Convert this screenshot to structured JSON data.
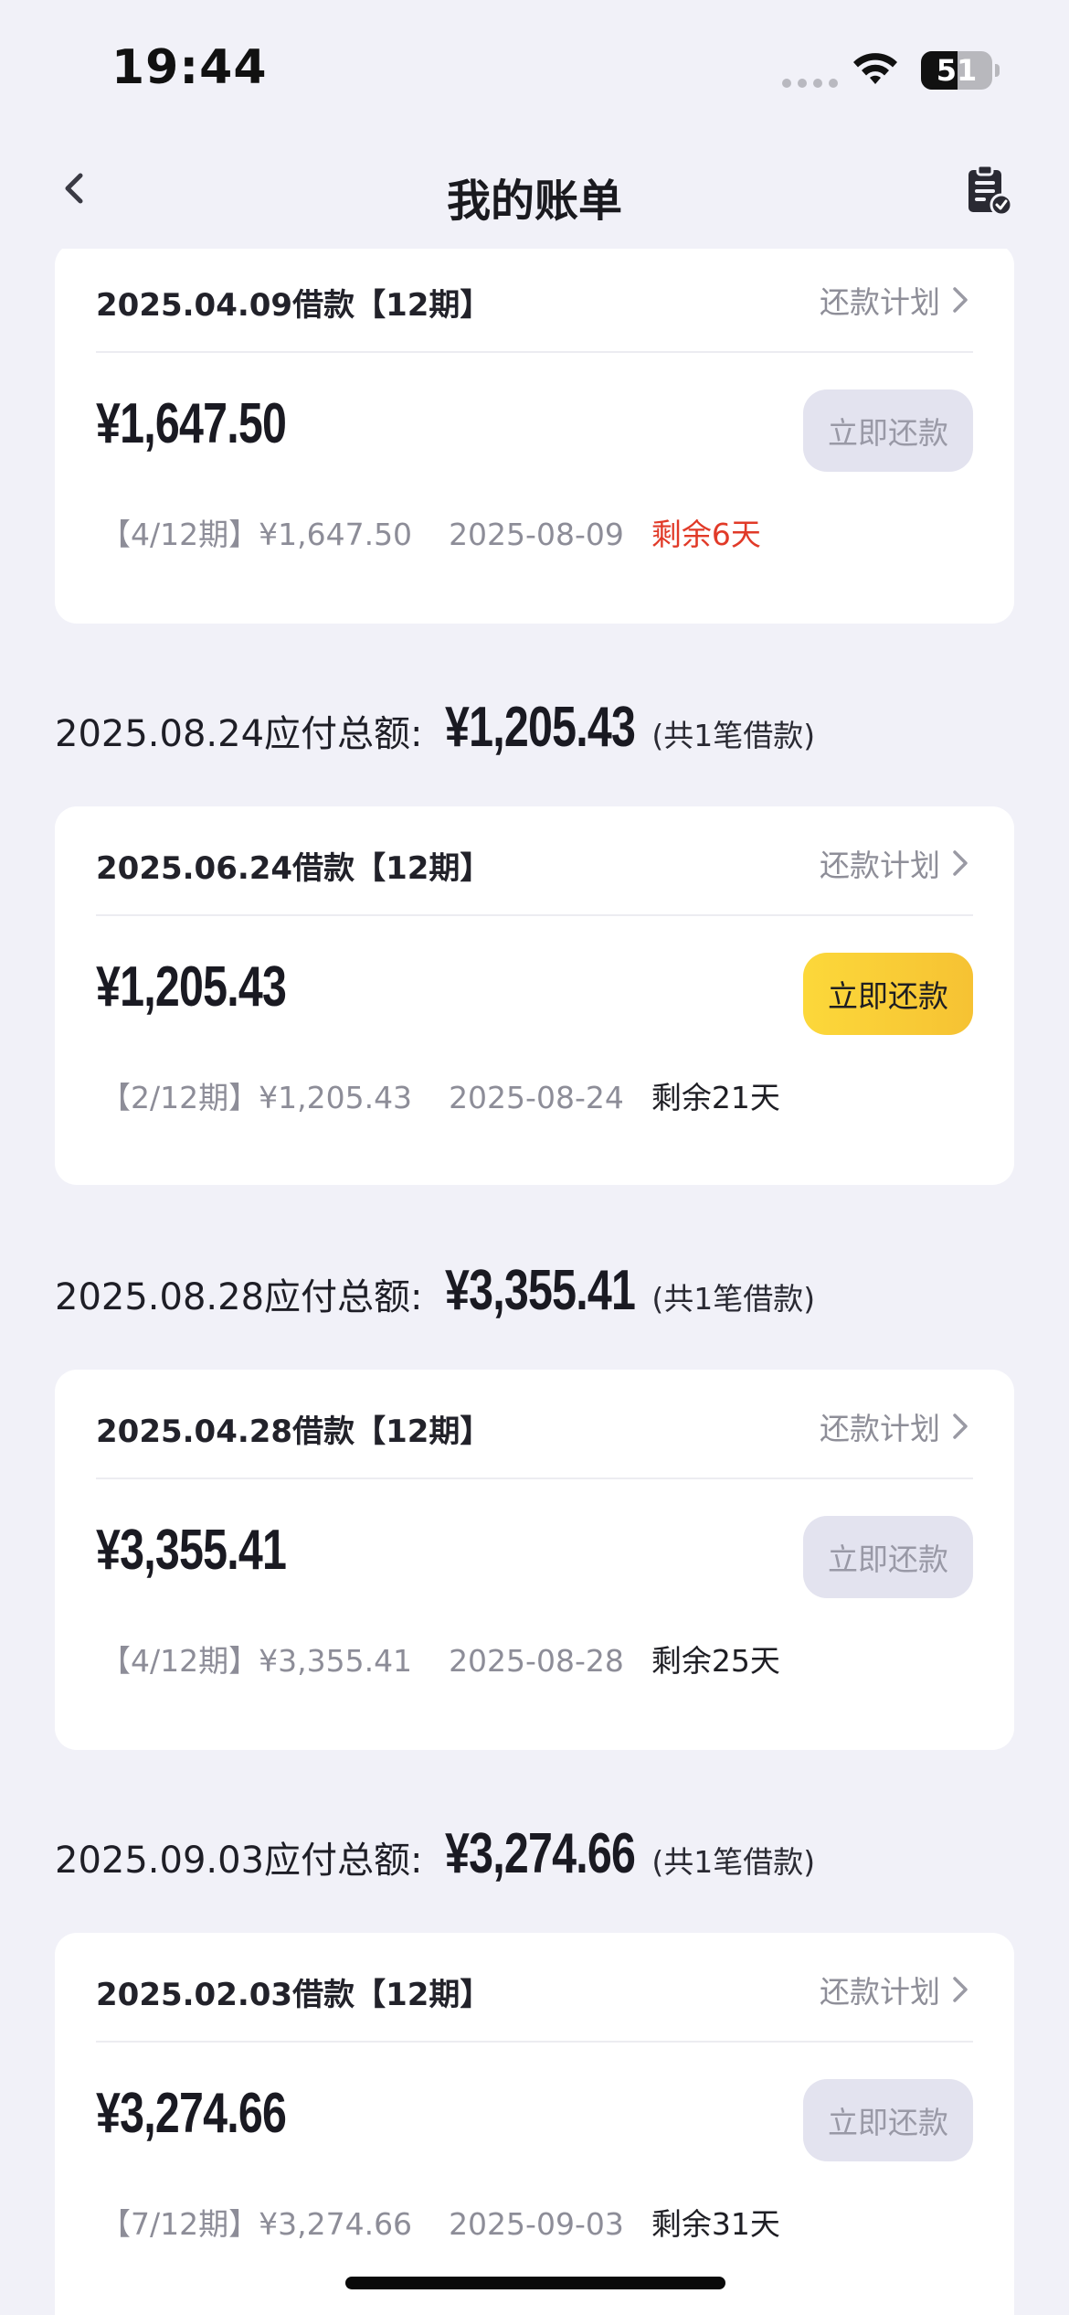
{
  "status_bar": {
    "time": "19:44",
    "battery_level": "51",
    "battery_fraction": 0.51
  },
  "nav": {
    "title": "我的账单",
    "back_icon": "chevron-left-icon",
    "action_icon": "bill-check-icon"
  },
  "colors": {
    "background": "#f1f1f8",
    "accent_yellow": "#fcd83a",
    "urgent_red": "#e13a28",
    "disabled_button": "#e3e3ef"
  },
  "groups": [
    {
      "header": null,
      "card": {
        "title": "2025.04.09借款【12期】",
        "plan_label": "还款计划",
        "amount": "¥1,647.50",
        "button_label": "立即还款",
        "button_enabled": false,
        "installment": "【4/12期】¥1,647.50",
        "due_date": "2025-08-09",
        "remaining": "剩余6天",
        "urgent": true
      }
    },
    {
      "header": {
        "date_label": "2025.08.24应付总额:",
        "total": "¥1,205.43",
        "count": "(共1笔借款)"
      },
      "card": {
        "title": "2025.06.24借款【12期】",
        "plan_label": "还款计划",
        "amount": "¥1,205.43",
        "button_label": "立即还款",
        "button_enabled": true,
        "installment": "【2/12期】¥1,205.43",
        "due_date": "2025-08-24",
        "remaining": "剩余21天",
        "urgent": false
      }
    },
    {
      "header": {
        "date_label": "2025.08.28应付总额:",
        "total": "¥3,355.41",
        "count": "(共1笔借款)"
      },
      "card": {
        "title": "2025.04.28借款【12期】",
        "plan_label": "还款计划",
        "amount": "¥3,355.41",
        "button_label": "立即还款",
        "button_enabled": false,
        "installment": "【4/12期】¥3,355.41",
        "due_date": "2025-08-28",
        "remaining": "剩余25天",
        "urgent": false
      }
    },
    {
      "header": {
        "date_label": "2025.09.03应付总额:",
        "total": "¥3,274.66",
        "count": "(共1笔借款)"
      },
      "card": {
        "title": "2025.02.03借款【12期】",
        "plan_label": "还款计划",
        "amount": "¥3,274.66",
        "button_label": "立即还款",
        "button_enabled": false,
        "installment": "【7/12期】¥3,274.66",
        "due_date": "2025-09-03",
        "remaining": "剩余31天",
        "urgent": false
      }
    }
  ]
}
